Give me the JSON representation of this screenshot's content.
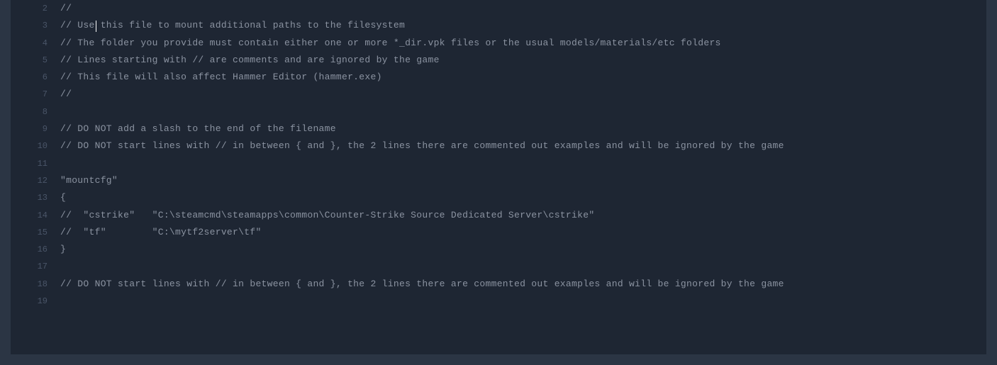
{
  "editor": {
    "lines": [
      {
        "num": "2",
        "text": "//"
      },
      {
        "num": "3",
        "text": "// Use this file to mount additional paths to the filesystem"
      },
      {
        "num": "4",
        "text": "// The folder you provide must contain either one or more *_dir.vpk files or the usual models/materials/etc folders"
      },
      {
        "num": "5",
        "text": "// Lines starting with // are comments and are ignored by the game"
      },
      {
        "num": "6",
        "text": "// This file will also affect Hammer Editor (hammer.exe)"
      },
      {
        "num": "7",
        "text": "//"
      },
      {
        "num": "8",
        "text": ""
      },
      {
        "num": "9",
        "text": "// DO NOT add a slash to the end of the filename"
      },
      {
        "num": "10",
        "text": "// DO NOT start lines with // in between { and }, the 2 lines there are commented out examples and will be ignored by the game"
      },
      {
        "num": "11",
        "text": ""
      },
      {
        "num": "12",
        "text": "\"mountcfg\""
      },
      {
        "num": "13",
        "text": "{"
      },
      {
        "num": "14",
        "text": "//  \"cstrike\"   \"C:\\steamcmd\\steamapps\\common\\Counter-Strike Source Dedicated Server\\cstrike\""
      },
      {
        "num": "15",
        "text": "//  \"tf\"        \"C:\\mytf2server\\tf\""
      },
      {
        "num": "16",
        "text": "}"
      },
      {
        "num": "17",
        "text": ""
      },
      {
        "num": "18",
        "text": "// DO NOT start lines with // in between { and }, the 2 lines there are commented out examples and will be ignored by the game"
      },
      {
        "num": "19",
        "text": ""
      }
    ]
  }
}
